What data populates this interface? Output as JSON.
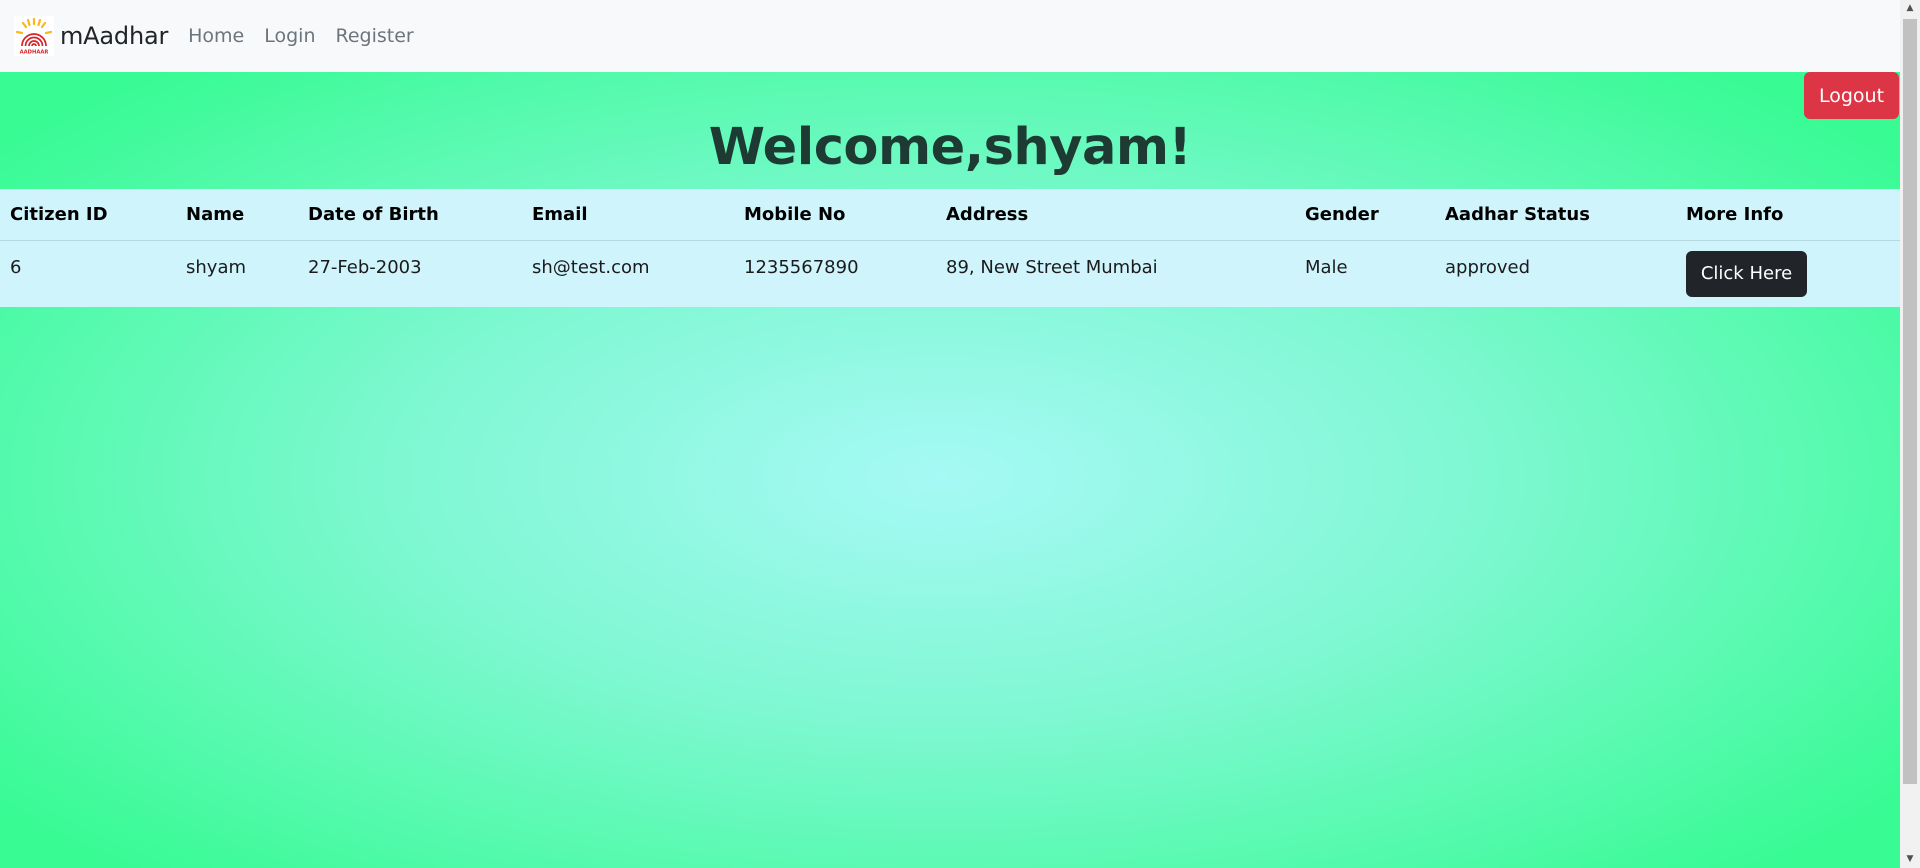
{
  "navbar": {
    "brand": "mAadhar",
    "logo_text": "AADHAAR",
    "links": [
      "Home",
      "Login",
      "Register"
    ]
  },
  "logout_label": "Logout",
  "welcome": "Welcome,shyam!",
  "table": {
    "headers": [
      "Citizen ID",
      "Name",
      "Date of Birth",
      "Email",
      "Mobile No",
      "Address",
      "Gender",
      "Aadhar Status",
      "More Info"
    ],
    "rows": [
      {
        "citizen_id": "6",
        "name": "shyam",
        "dob": "27-Feb-2003",
        "email": "sh@test.com",
        "mobile": "1235567890",
        "address": "89, New Street Mumbai",
        "gender": "Male",
        "status": "approved",
        "more_info_label": "Click Here"
      }
    ]
  },
  "colors": {
    "navbar_bg": "#f8f9fa",
    "logout_btn": "#dc3545",
    "table_bg": "#cff4fc",
    "click_btn": "#212529",
    "bg_center": "#a6f9f5",
    "bg_edge": "#38fb94"
  }
}
